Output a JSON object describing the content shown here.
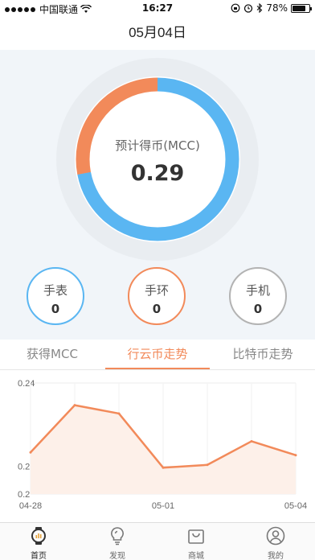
{
  "status_bar": {
    "carrier": "中国联通",
    "time": "16:27",
    "battery": "78%",
    "battery_level": 0.78
  },
  "header": {
    "date": "05月04日"
  },
  "ring": {
    "label": "预计得币(MCC)",
    "value": "0.29",
    "orange_fraction": 0.28,
    "colors": {
      "blue": "#5ab6f2",
      "orange": "#f28a5a"
    }
  },
  "devices": [
    {
      "name": "手表",
      "count": "0",
      "color": "#5ab6f2"
    },
    {
      "name": "手环",
      "count": "0",
      "color": "#f28a5a"
    },
    {
      "name": "手机",
      "count": "0",
      "color": "#b3b3b3"
    }
  ],
  "tabs": [
    {
      "label": "获得MCC",
      "active": false
    },
    {
      "label": "行云币走势",
      "active": true
    },
    {
      "label": "比特币走势",
      "active": false
    }
  ],
  "chart_data": {
    "type": "area",
    "x": [
      "04-28",
      "04-29",
      "04-30",
      "05-01",
      "05-02",
      "05-03",
      "05-04"
    ],
    "values": [
      0.215,
      0.232,
      0.229,
      0.2095,
      0.2105,
      0.219,
      0.214
    ],
    "x_tick_labels": [
      "04-28",
      "05-01",
      "05-04"
    ],
    "y_ticks": [
      0.2,
      0.21,
      0.24
    ],
    "y_tick_labels": [
      "0.2",
      "0.21",
      "0.24"
    ],
    "ylim": [
      0.2,
      0.24
    ],
    "grid": true,
    "color": "#f28a5a",
    "fill": "#fdf0e9"
  },
  "bottom_nav": [
    {
      "label": "首页",
      "icon": "watch-icon",
      "active": true
    },
    {
      "label": "发现",
      "icon": "lightbulb-icon",
      "active": false
    },
    {
      "label": "商城",
      "icon": "shopping-bag-icon",
      "active": false
    },
    {
      "label": "我的",
      "icon": "user-icon",
      "active": false
    }
  ]
}
